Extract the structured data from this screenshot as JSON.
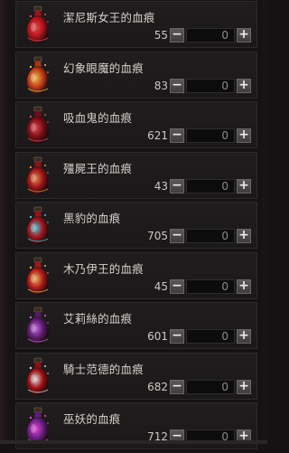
{
  "items": [
    {
      "name": "潔尼斯女王的血痕",
      "count": "55",
      "qty": "0",
      "minus": "−",
      "plus": "+",
      "icon": "red-potion-icon",
      "color": "#b3121d",
      "accent": "#e04a4a"
    },
    {
      "name": "幻象眼魔的血痕",
      "count": "83",
      "qty": "0",
      "minus": "−",
      "plus": "+",
      "icon": "gold-potion-icon",
      "color": "#c23a18",
      "accent": "#e5b94a"
    },
    {
      "name": "吸血鬼的血痕",
      "count": "621",
      "qty": "0",
      "minus": "−",
      "plus": "+",
      "icon": "dark-red-potion-icon",
      "color": "#7d0d16",
      "accent": "#d44a55"
    },
    {
      "name": "殭屍王的血痕",
      "count": "43",
      "qty": "0",
      "minus": "−",
      "plus": "+",
      "icon": "crimson-potion-icon",
      "color": "#9e1218",
      "accent": "#d98a4a"
    },
    {
      "name": "黑豹的血痕",
      "count": "705",
      "qty": "0",
      "minus": "−",
      "plus": "+",
      "icon": "teal-potion-icon",
      "color": "#a0141c",
      "accent": "#4ec3d6"
    },
    {
      "name": "木乃伊王的血痕",
      "count": "45",
      "qty": "0",
      "minus": "−",
      "plus": "+",
      "icon": "amber-potion-icon",
      "color": "#b21a1a",
      "accent": "#e2b35a"
    },
    {
      "name": "艾莉絲的血痕",
      "count": "601",
      "qty": "0",
      "minus": "−",
      "plus": "+",
      "icon": "purple-potion-icon",
      "color": "#5b1b6e",
      "accent": "#c06ad6"
    },
    {
      "name": "騎士范德的血痕",
      "count": "682",
      "qty": "0",
      "minus": "−",
      "plus": "+",
      "icon": "blood-potion-icon",
      "color": "#9e0e14",
      "accent": "#d8d8d8"
    },
    {
      "name": "巫妖的血痕",
      "count": "712",
      "qty": "0",
      "minus": "−",
      "plus": "+",
      "icon": "violet-potion-icon",
      "color": "#6a1f86",
      "accent": "#e14ad0"
    }
  ]
}
